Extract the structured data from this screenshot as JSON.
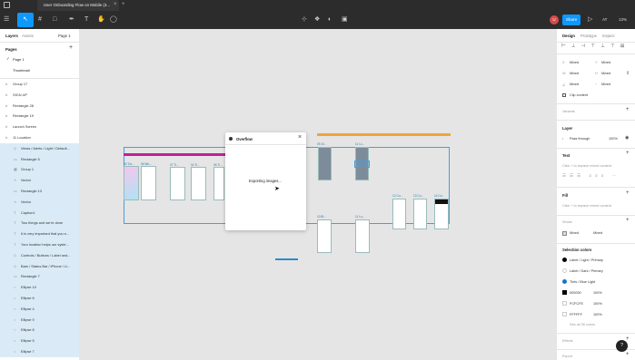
{
  "tab": {
    "title": "User Onboarding Flow on Mobile (3...",
    "close": "×",
    "new": "+"
  },
  "toolbar": {
    "share": "Share",
    "zoom": "13%",
    "avatar": "U",
    "user_initials": "AT"
  },
  "left_panel": {
    "tabs": [
      "Layers",
      "Assets"
    ],
    "page_selector": "Page 1",
    "pages_header": "Pages",
    "pages": [
      "Page 1",
      "Thumbnail"
    ],
    "layers": [
      {
        "label": "Group 17",
        "icon": "frame-icon",
        "sel": false
      },
      {
        "label": "SIGN UP",
        "icon": "frame-icon",
        "sel": false
      },
      {
        "label": "Rectangle 28",
        "icon": "frame-icon",
        "sel": false
      },
      {
        "label": "Rectangle 19",
        "icon": "frame-icon",
        "sel": false
      },
      {
        "label": "Launch Screen",
        "icon": "frame-icon",
        "sel": false
      },
      {
        "label": "11 Location",
        "icon": "frame-icon",
        "sel": false
      },
      {
        "label": "Views / Alerts / Light / Default...",
        "icon": "component-icon",
        "sel": true
      },
      {
        "label": "Rectangle 5",
        "icon": "rect-icon",
        "sel": true
      },
      {
        "label": "Group 1",
        "icon": "group-icon",
        "sel": true
      },
      {
        "label": "Vector",
        "icon": "vector-icon",
        "sel": true
      },
      {
        "label": "Rectangle 13",
        "icon": "rect-icon",
        "sel": true
      },
      {
        "label": "Vector",
        "icon": "vector-icon",
        "sel": true
      },
      {
        "label": "Caption1",
        "icon": "text-icon",
        "sel": true
      },
      {
        "label": "Two things and we're done",
        "icon": "text-icon",
        "sel": true
      },
      {
        "label": "It is very important that you s...",
        "icon": "text-icon",
        "sel": true
      },
      {
        "label": "Your location helps our syste...",
        "icon": "text-icon",
        "sel": true
      },
      {
        "label": "Controls / Buttons / Label and...",
        "icon": "component-icon",
        "sel": true
      },
      {
        "label": "Bars / Status Bar / iPhone / Li...",
        "icon": "component-icon",
        "sel": true
      },
      {
        "label": "Rectangle 7",
        "icon": "rect-icon",
        "sel": true
      },
      {
        "label": "Ellipse 10",
        "icon": "ellipse-icon",
        "sel": true
      },
      {
        "label": "Ellipse 6",
        "icon": "ellipse-icon",
        "sel": true
      },
      {
        "label": "Ellipse 4",
        "icon": "ellipse-icon",
        "sel": true
      },
      {
        "label": "Ellipse 9",
        "icon": "ellipse-icon",
        "sel": true
      },
      {
        "label": "Ellipse 8",
        "icon": "ellipse-icon",
        "sel": true
      },
      {
        "label": "Ellipse 5",
        "icon": "ellipse-icon",
        "sel": true
      },
      {
        "label": "Ellipse 7",
        "icon": "ellipse-icon",
        "sel": true
      }
    ]
  },
  "canvas": {
    "frame_labels": [
      "09 Tut...",
      "06 Wh...",
      "07 Ti...",
      "04 Ti...",
      "05 Ti...",
      "09 10...",
      "11 Lo...",
      "12 Co...",
      "13 Co...",
      "14 Co...",
      "10 Bl...",
      "11 Lo..."
    ],
    "dialog": {
      "title": "Overflow",
      "close": "×",
      "message": "Exporting images..."
    }
  },
  "right_panel": {
    "tabs": [
      "Design",
      "Prototype",
      "Inspect"
    ],
    "mixed_rows": [
      [
        "Mixed",
        "Mixed"
      ],
      [
        "Mixed",
        "Mixed"
      ],
      [
        "Mixed",
        "Mixed"
      ]
    ],
    "clip_content": "Clip content",
    "variants": "Variants",
    "layer_header": "Layer",
    "layer_blend": "Pass through",
    "layer_opacity": "100%",
    "text_header": "Text",
    "text_hint": "Click + to replace mixed content",
    "fill_header": "Fill",
    "fill_hint": "Click + to replace mixed content",
    "stroke_header": "Stroke",
    "stroke_values": [
      "Mixed",
      "Mixed"
    ],
    "selection_colors_header": "Selection colors",
    "colors": [
      {
        "name": "Label / Light / Primary",
        "color": "#000000",
        "kind": "dot"
      },
      {
        "name": "Label / Dark / Primary",
        "color": "#ffffff",
        "kind": "dot"
      },
      {
        "name": "Tints / Blue Light",
        "color": "#1a73c9",
        "kind": "dot"
      },
      {
        "name": "000000",
        "color": "#000000",
        "kind": "square",
        "pct": "100%"
      },
      {
        "name": "FCFCFE",
        "color": "#fcfcfe",
        "kind": "square",
        "pct": "100%"
      },
      {
        "name": "FFFFFF",
        "color": "#ffffff",
        "kind": "square",
        "pct": "100%"
      }
    ],
    "see_all": "See all 36 colors",
    "effects": "Effects",
    "export": "Export"
  },
  "help": "?"
}
